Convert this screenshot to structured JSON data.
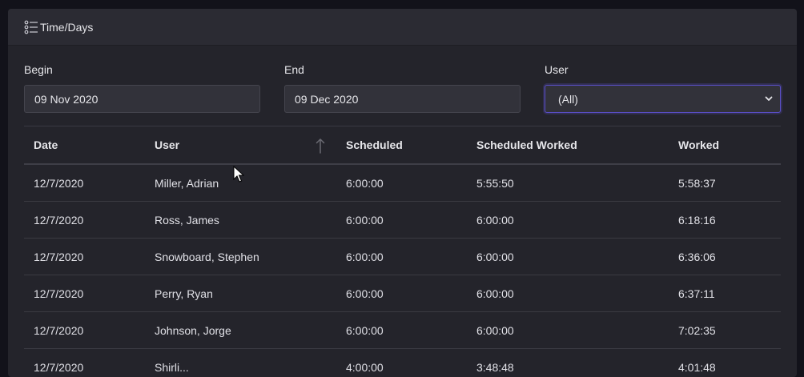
{
  "header": {
    "title": "Time/Days",
    "icon": "list-icon"
  },
  "filters": {
    "begin_label": "Begin",
    "begin_value": "09 Nov 2020",
    "end_label": "End",
    "end_value": "09 Dec 2020",
    "user_label": "User",
    "user_value": "(All)"
  },
  "table": {
    "columns": [
      "Date",
      "User",
      "Scheduled",
      "Scheduled Worked",
      "Worked"
    ],
    "sorted_column": "User",
    "rows": [
      [
        "12/7/2020",
        "Miller, Adrian",
        "6:00:00",
        "5:55:50",
        "5:58:37"
      ],
      [
        "12/7/2020",
        "Ross, James",
        "6:00:00",
        "6:00:00",
        "6:18:16"
      ],
      [
        "12/7/2020",
        "Snowboard, Stephen",
        "6:00:00",
        "6:00:00",
        "6:36:06"
      ],
      [
        "12/7/2020",
        "Perry, Ryan",
        "6:00:00",
        "6:00:00",
        "6:37:11"
      ],
      [
        "12/7/2020",
        "Johnson, Jorge",
        "6:00:00",
        "6:00:00",
        "7:02:35"
      ],
      [
        "12/7/2020",
        "Shirli...",
        "4:00:00",
        "3:48:48",
        "4:01:48"
      ]
    ]
  },
  "colors": {
    "background": "#12121a",
    "card": "#24242b",
    "accent": "#5a4fc8"
  }
}
